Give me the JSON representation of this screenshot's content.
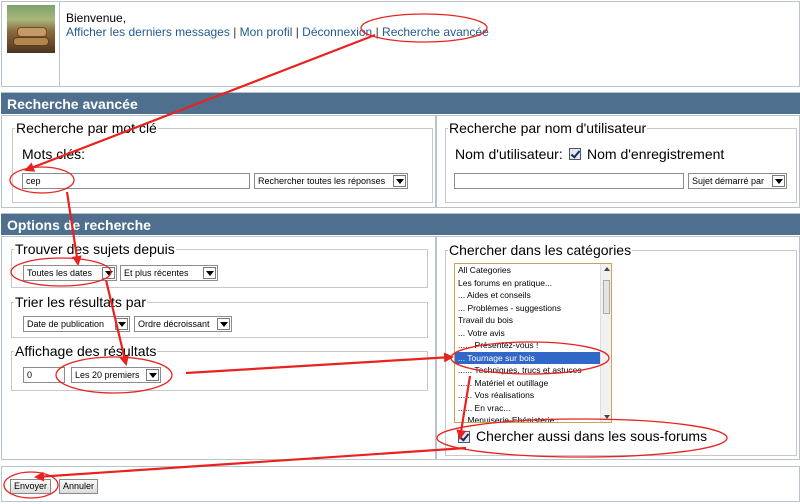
{
  "header": {
    "greeting": "Bienvenue,",
    "links": [
      "Afficher les derniers messages",
      "Mon profil",
      "Déconnexion",
      "Recherche avancée"
    ],
    "separator": "|"
  },
  "advanced_search": {
    "title": "Recherche avancée",
    "keyword_panel": {
      "legend": "Recherche par mot clé",
      "keywords_label": "Mots clés:",
      "keywords_value": "cep",
      "mode_select": "Rechercher toutes les réponses"
    },
    "username_panel": {
      "legend": "Recherche par nom d'utilisateur",
      "username_label": "Nom d'utilisateur:",
      "exact_name_label": "Nom d'enregistrement",
      "exact_name_checked": true,
      "username_value": "",
      "scope_select": "Sujet démarré par"
    }
  },
  "search_options": {
    "title": "Options de recherche",
    "find_since": {
      "legend": "Trouver des sujets depuis",
      "period_select": "Toutes les dates",
      "direction_select": "Et plus récentes"
    },
    "sort": {
      "legend": "Trier les résultats par",
      "sort_field_select": "Date de publication",
      "sort_order_select": "Ordre décroissant"
    },
    "display": {
      "legend": "Affichage des résultats",
      "offset_value": "0",
      "count_select": "Les 20 premiers"
    },
    "categories": {
      "legend": "Chercher dans les catégories",
      "options": [
        "All Categories",
        "Les forums en pratique...",
        "... Aides et conseils",
        "... Problèmes - suggestions",
        "Travail du bois",
        "... Votre avis",
        "...... Présentez-vous !",
        "... Tournage sur bois",
        "...... Techniques, trucs et astuces",
        "...... Matériel et outillage",
        "...... Vos réalisations",
        "...... En vrac...",
        "... Menuiserie-Ebénisterie"
      ],
      "selected_index": 7,
      "subforums_label": "Chercher aussi dans les sous-forums",
      "subforums_checked": true
    }
  },
  "actions": {
    "submit": "Envoyer",
    "cancel": "Annuler"
  },
  "annotation_colors": {
    "arrow": "#e8231f",
    "highlight": "#3167c7",
    "section_bar": "#4f6f8f"
  }
}
